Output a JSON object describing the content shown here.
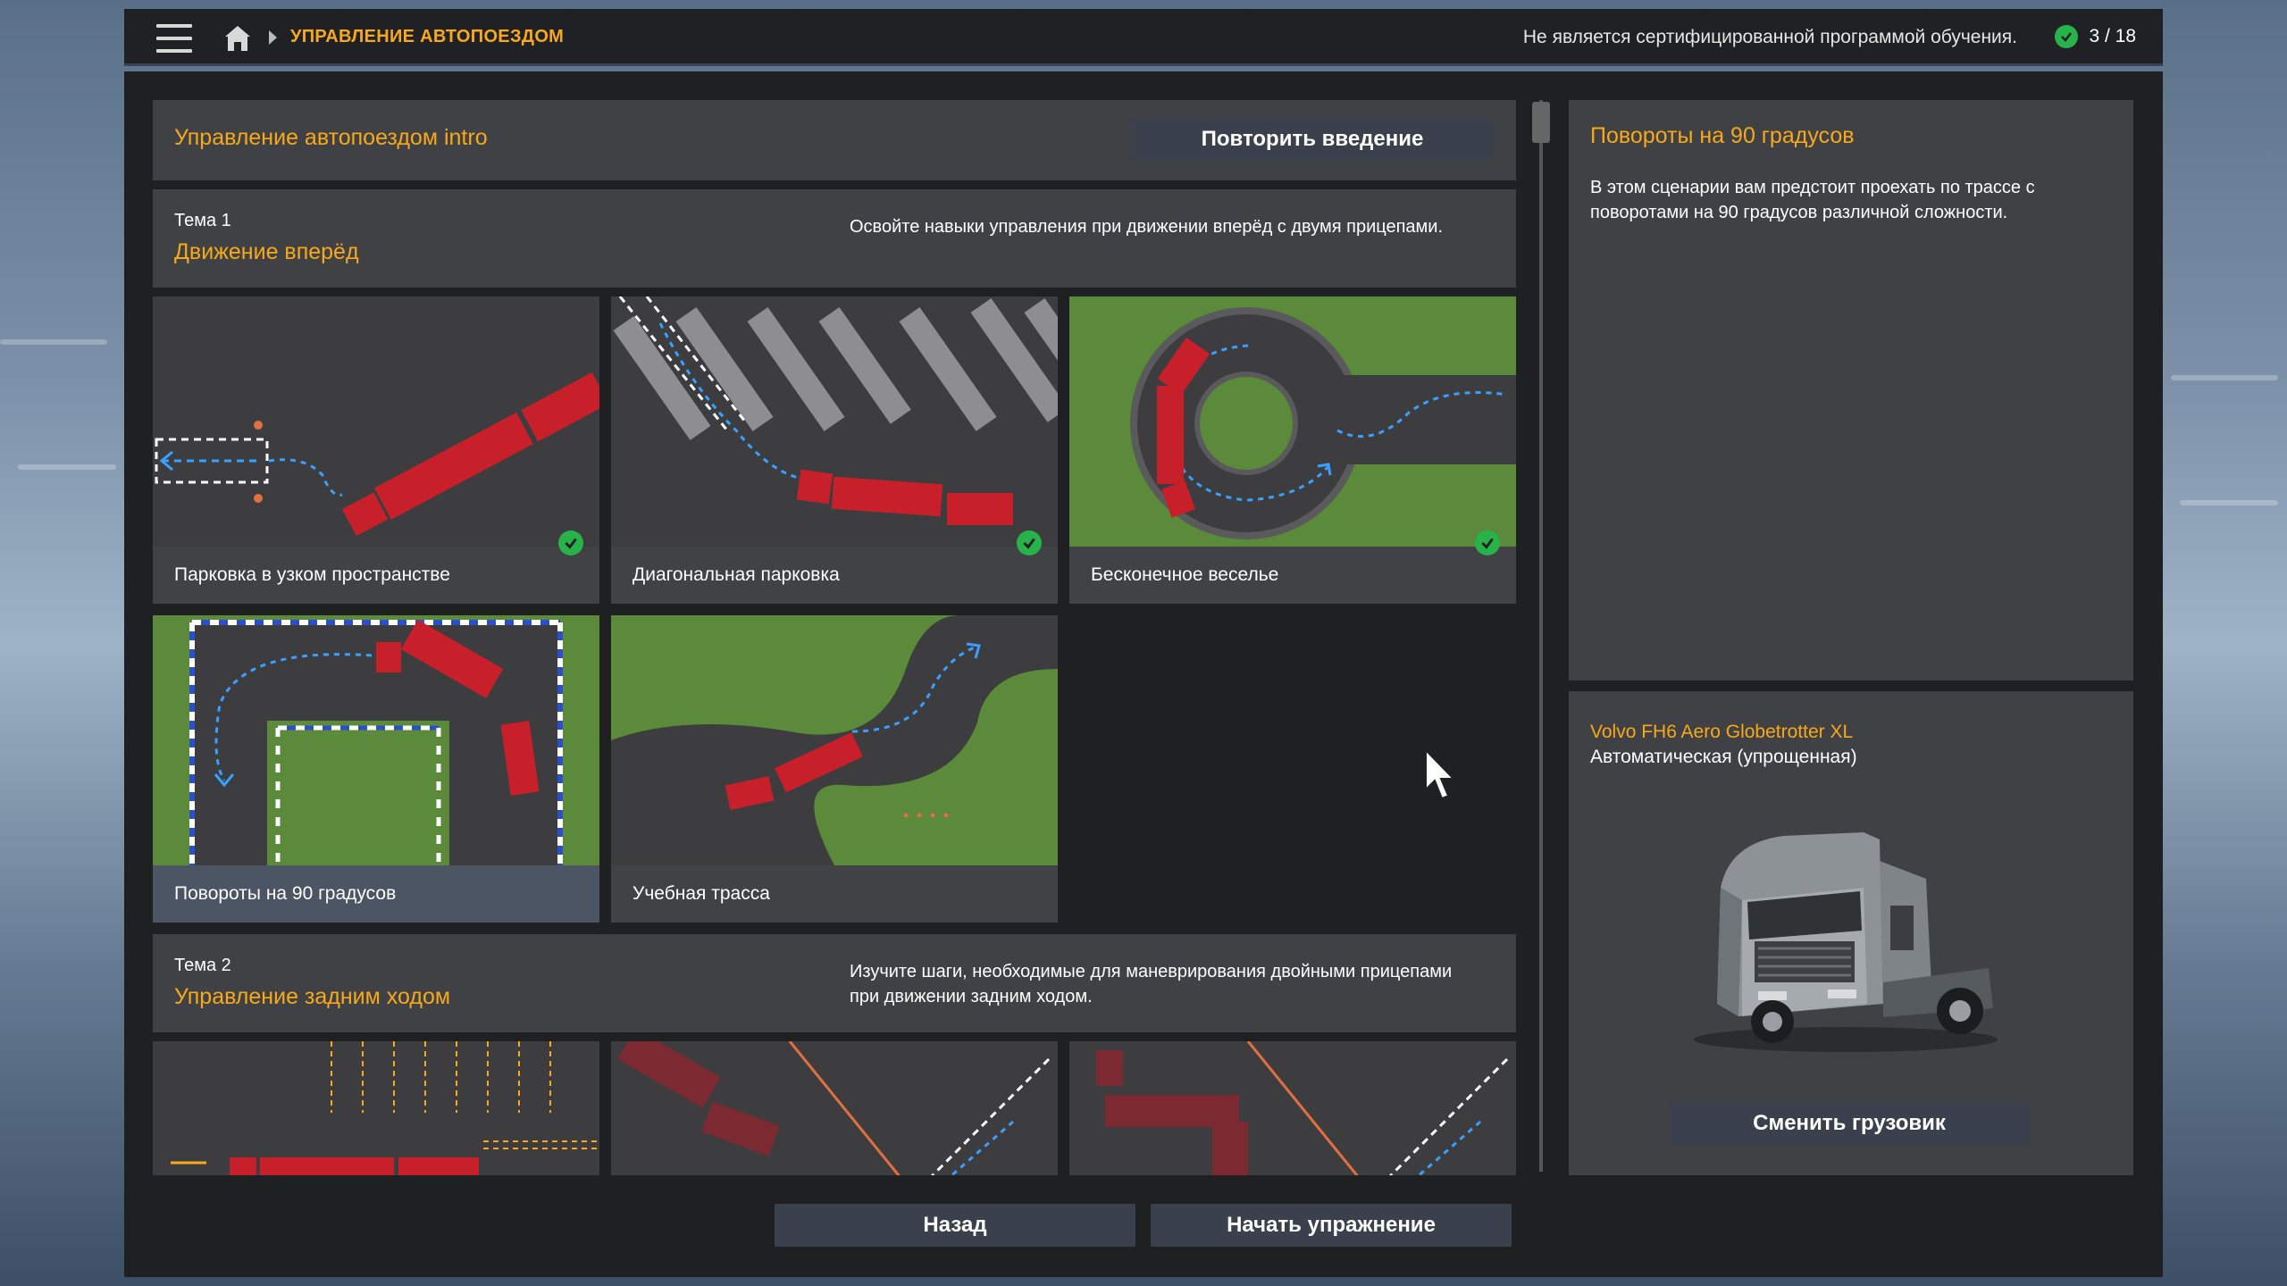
{
  "topbar": {
    "breadcrumb": "УПРАВЛЕНИЕ АВТОПОЕЗДОМ",
    "cert_note": "Не является сертифицированной программой обучения.",
    "progress": "3 / 18"
  },
  "intro": {
    "title": "Управление автопоездом intro",
    "repeat_button": "Повторить введение"
  },
  "topics": [
    {
      "number": "Тема 1",
      "title": "Движение вперёд",
      "description": "Освойте навыки управления при движении вперёд с двумя прицепами.",
      "exercises": [
        {
          "label": "Парковка в узком пространстве",
          "completed": true
        },
        {
          "label": "Диагональная парковка",
          "completed": true
        },
        {
          "label": "Бесконечное веселье",
          "completed": true
        },
        {
          "label": "Повороты на 90 градусов",
          "completed": false,
          "selected": true
        },
        {
          "label": "Учебная трасса",
          "completed": false
        }
      ]
    },
    {
      "number": "Тема 2",
      "title": "Управление задним ходом",
      "description": "Изучите шаги, необходимые для маневрирования двойными прицепами при движении задним ходом."
    }
  ],
  "details": {
    "title": "Повороты на 90 градусов",
    "description": "В этом сценарии вам предстоит проехать по трассе с поворотами на 90 градусов различной сложности."
  },
  "truck": {
    "name": "Volvo FH6 Aero Globetrotter XL",
    "transmission": "Автоматическая (упрощенная)",
    "change_button": "Сменить грузовик"
  },
  "footer": {
    "back_button": "Назад",
    "start_button": "Начать упражнение"
  },
  "colors": {
    "accent": "#f7a91b",
    "check": "#27b34a",
    "panel": "#3f4144",
    "button": "#3a414c"
  }
}
